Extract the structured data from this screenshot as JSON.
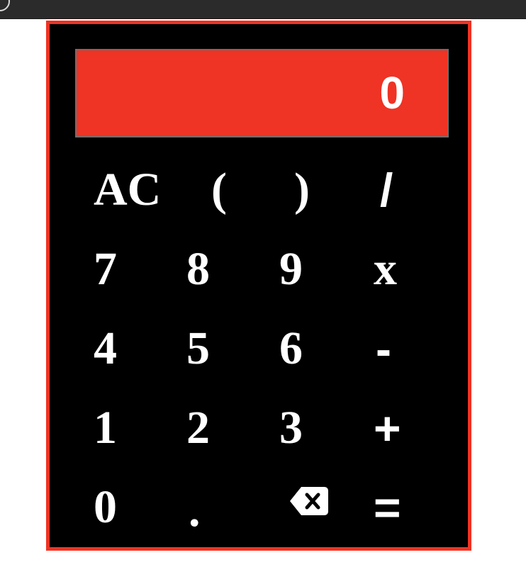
{
  "display": {
    "value": "0"
  },
  "keys": {
    "ac": "AC",
    "open_paren": "(",
    "close_paren": ")",
    "divide": "/",
    "seven": "7",
    "eight": "8",
    "nine": "9",
    "multiply": "x",
    "four": "4",
    "five": "5",
    "six": "6",
    "subtract": "-",
    "one": "1",
    "two": "2",
    "three": "3",
    "add": "+",
    "zero": "0",
    "decimal": ".",
    "backspace": "backspace-icon",
    "equals": "="
  },
  "colors": {
    "accent": "#ef3324",
    "panel": "#000000",
    "text": "#ffffff"
  }
}
